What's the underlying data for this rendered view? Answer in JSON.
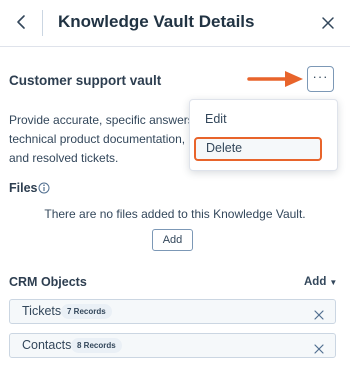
{
  "header": {
    "title": "Knowledge Vault Details",
    "back_icon": "chevron-left-icon",
    "close_icon": "close-icon"
  },
  "vault": {
    "name": "Customer support vault",
    "more_label": "···",
    "description_line1": "Provide accurate, specific answers to",
    "description_line2": "technical product documentation, pro",
    "description_line3": "and resolved tickets."
  },
  "menu": {
    "items": [
      {
        "label": "Edit"
      },
      {
        "label": "Delete",
        "highlighted": true
      }
    ]
  },
  "files": {
    "label": "Files",
    "empty_text": "There are no files added to this Knowledge Vault.",
    "add_label": "Add"
  },
  "crm": {
    "label": "CRM Objects",
    "add_label": "Add",
    "rows": [
      {
        "name": "Tickets",
        "badge": "7 Records"
      },
      {
        "name": "Contacts",
        "badge": "8 Records"
      }
    ]
  },
  "colors": {
    "annotation_orange": "#e8642b",
    "text": "#33475b",
    "border": "#cbd6e2"
  }
}
